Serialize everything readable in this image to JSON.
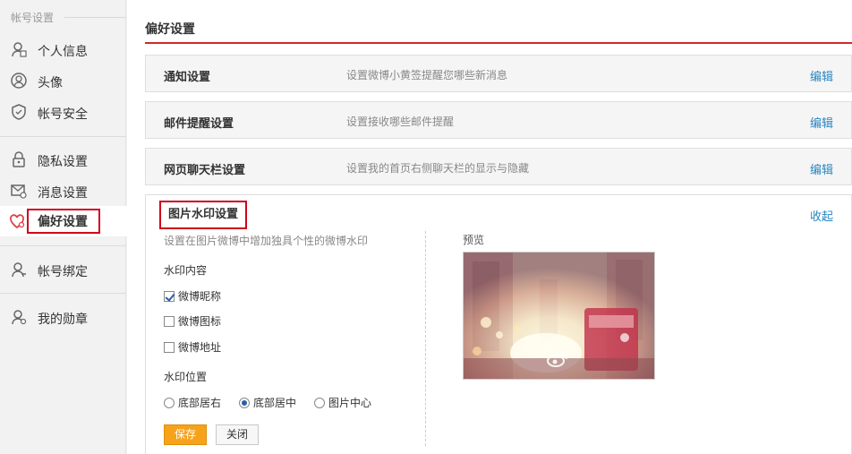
{
  "sidebar": {
    "heading": "帐号设置",
    "items": [
      {
        "label": "个人信息"
      },
      {
        "label": "头像"
      },
      {
        "label": "帐号安全"
      },
      {
        "label": "隐私设置"
      },
      {
        "label": "消息设置"
      },
      {
        "label": "偏好设置"
      },
      {
        "label": "帐号绑定"
      },
      {
        "label": "我的勋章"
      }
    ]
  },
  "main": {
    "title": "偏好设置",
    "rows": [
      {
        "title": "通知设置",
        "desc": "设置微博小黄签提醒您哪些新消息",
        "action": "编辑"
      },
      {
        "title": "邮件提醒设置",
        "desc": "设置接收哪些邮件提醒",
        "action": "编辑"
      },
      {
        "title": "网页聊天栏设置",
        "desc": "设置我的首页右侧聊天栏的显示与隐藏",
        "action": "编辑"
      }
    ],
    "watermark": {
      "title": "图片水印设置",
      "collapse": "收起",
      "desc": "设置在图片微博中增加独具个性的微博水印",
      "content_label": "水印内容",
      "content_options": [
        {
          "label": "微博昵称",
          "checked": true
        },
        {
          "label": "微博图标",
          "checked": false
        },
        {
          "label": "微博地址",
          "checked": false
        }
      ],
      "position_label": "水印位置",
      "position_options": [
        {
          "label": "底部居右",
          "selected": false
        },
        {
          "label": "底部居中",
          "selected": true
        },
        {
          "label": "图片中心",
          "selected": false
        }
      ],
      "save": "保存",
      "close": "关闭",
      "preview_label": "预览"
    }
  },
  "colors": {
    "accent_red": "#d0021b",
    "link_blue": "#2a86c2",
    "save_orange": "#f7a21b"
  }
}
